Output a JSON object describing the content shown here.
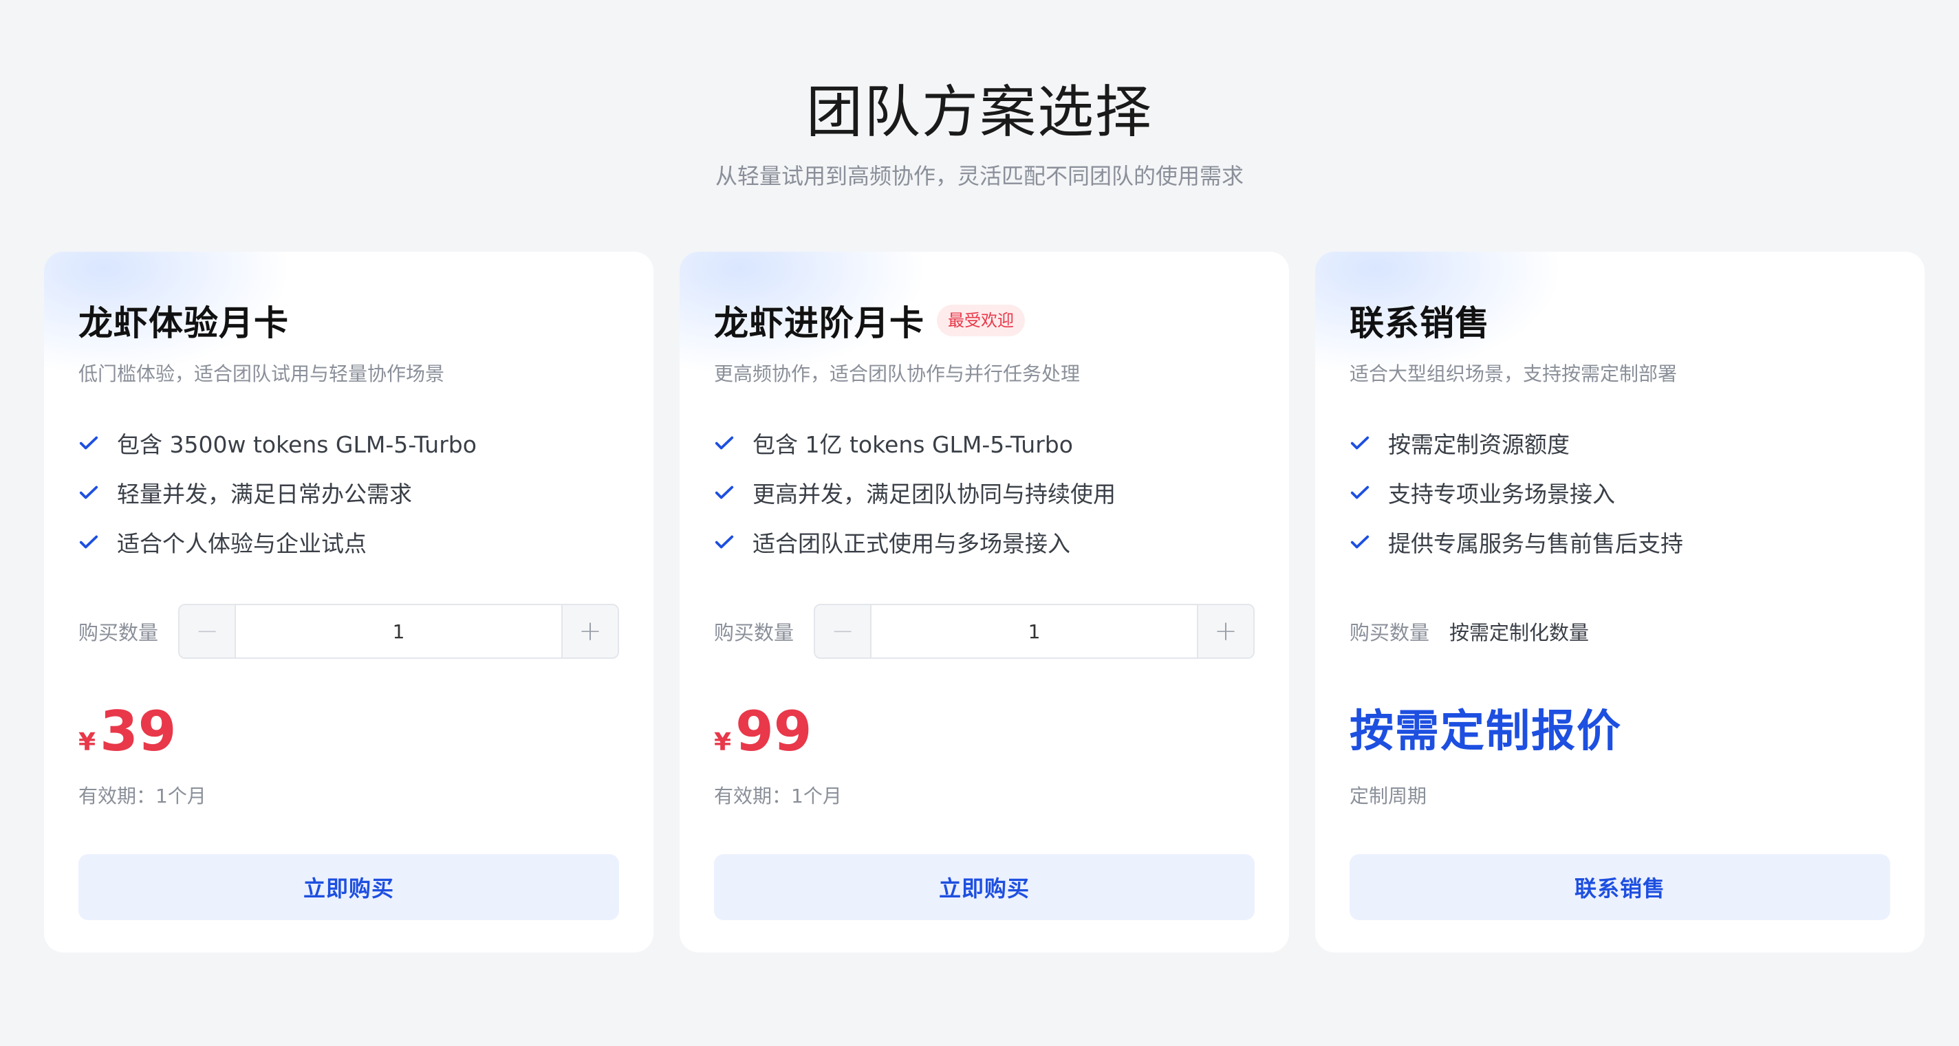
{
  "header": {
    "title": "团队方案选择",
    "subtitle": "从轻量试用到高频协作，灵活匹配不同团队的使用需求"
  },
  "colors": {
    "accent": "#1d4fe0",
    "price": "#e8384a",
    "badge_bg": "#feecec",
    "cta_bg": "#ecf1fe",
    "page_bg": "#f4f5f7"
  },
  "icons": {
    "check": "check-icon",
    "minus": "minus-icon",
    "plus": "plus-icon"
  },
  "plans": [
    {
      "title": "龙虾体验月卡",
      "badge": "",
      "desc": "低门槛体验，适合团队试用与轻量协作场景",
      "features": [
        "包含 3500w tokens GLM-5-Turbo",
        "轻量并发，满足日常办公需求",
        "适合个人体验与企业试点"
      ],
      "qty_label": "购买数量",
      "qty_value": "1",
      "minus": "−",
      "plus": "+",
      "currency": "¥",
      "price": "39",
      "validity": "有效期：1个月",
      "cta": "立即购买"
    },
    {
      "title": "龙虾进阶月卡",
      "badge": "最受欢迎",
      "desc": "更高频协作，适合团队协作与并行任务处理",
      "features": [
        "包含 1亿 tokens GLM-5-Turbo",
        "更高并发，满足团队协同与持续使用",
        "适合团队正式使用与多场景接入"
      ],
      "qty_label": "购买数量",
      "qty_value": "1",
      "minus": "−",
      "plus": "+",
      "currency": "¥",
      "price": "99",
      "validity": "有效期：1个月",
      "cta": "立即购买"
    },
    {
      "title": "联系销售",
      "desc": "适合大型组织场景，支持按需定制部署",
      "features": [
        "按需定制资源额度",
        "支持专项业务场景接入",
        "提供专属服务与售前售后支持"
      ],
      "qty_label": "购买数量",
      "qty_custom": "按需定制化数量",
      "price_custom": "按需定制报价",
      "validity": "定制周期",
      "cta": "联系销售"
    }
  ]
}
